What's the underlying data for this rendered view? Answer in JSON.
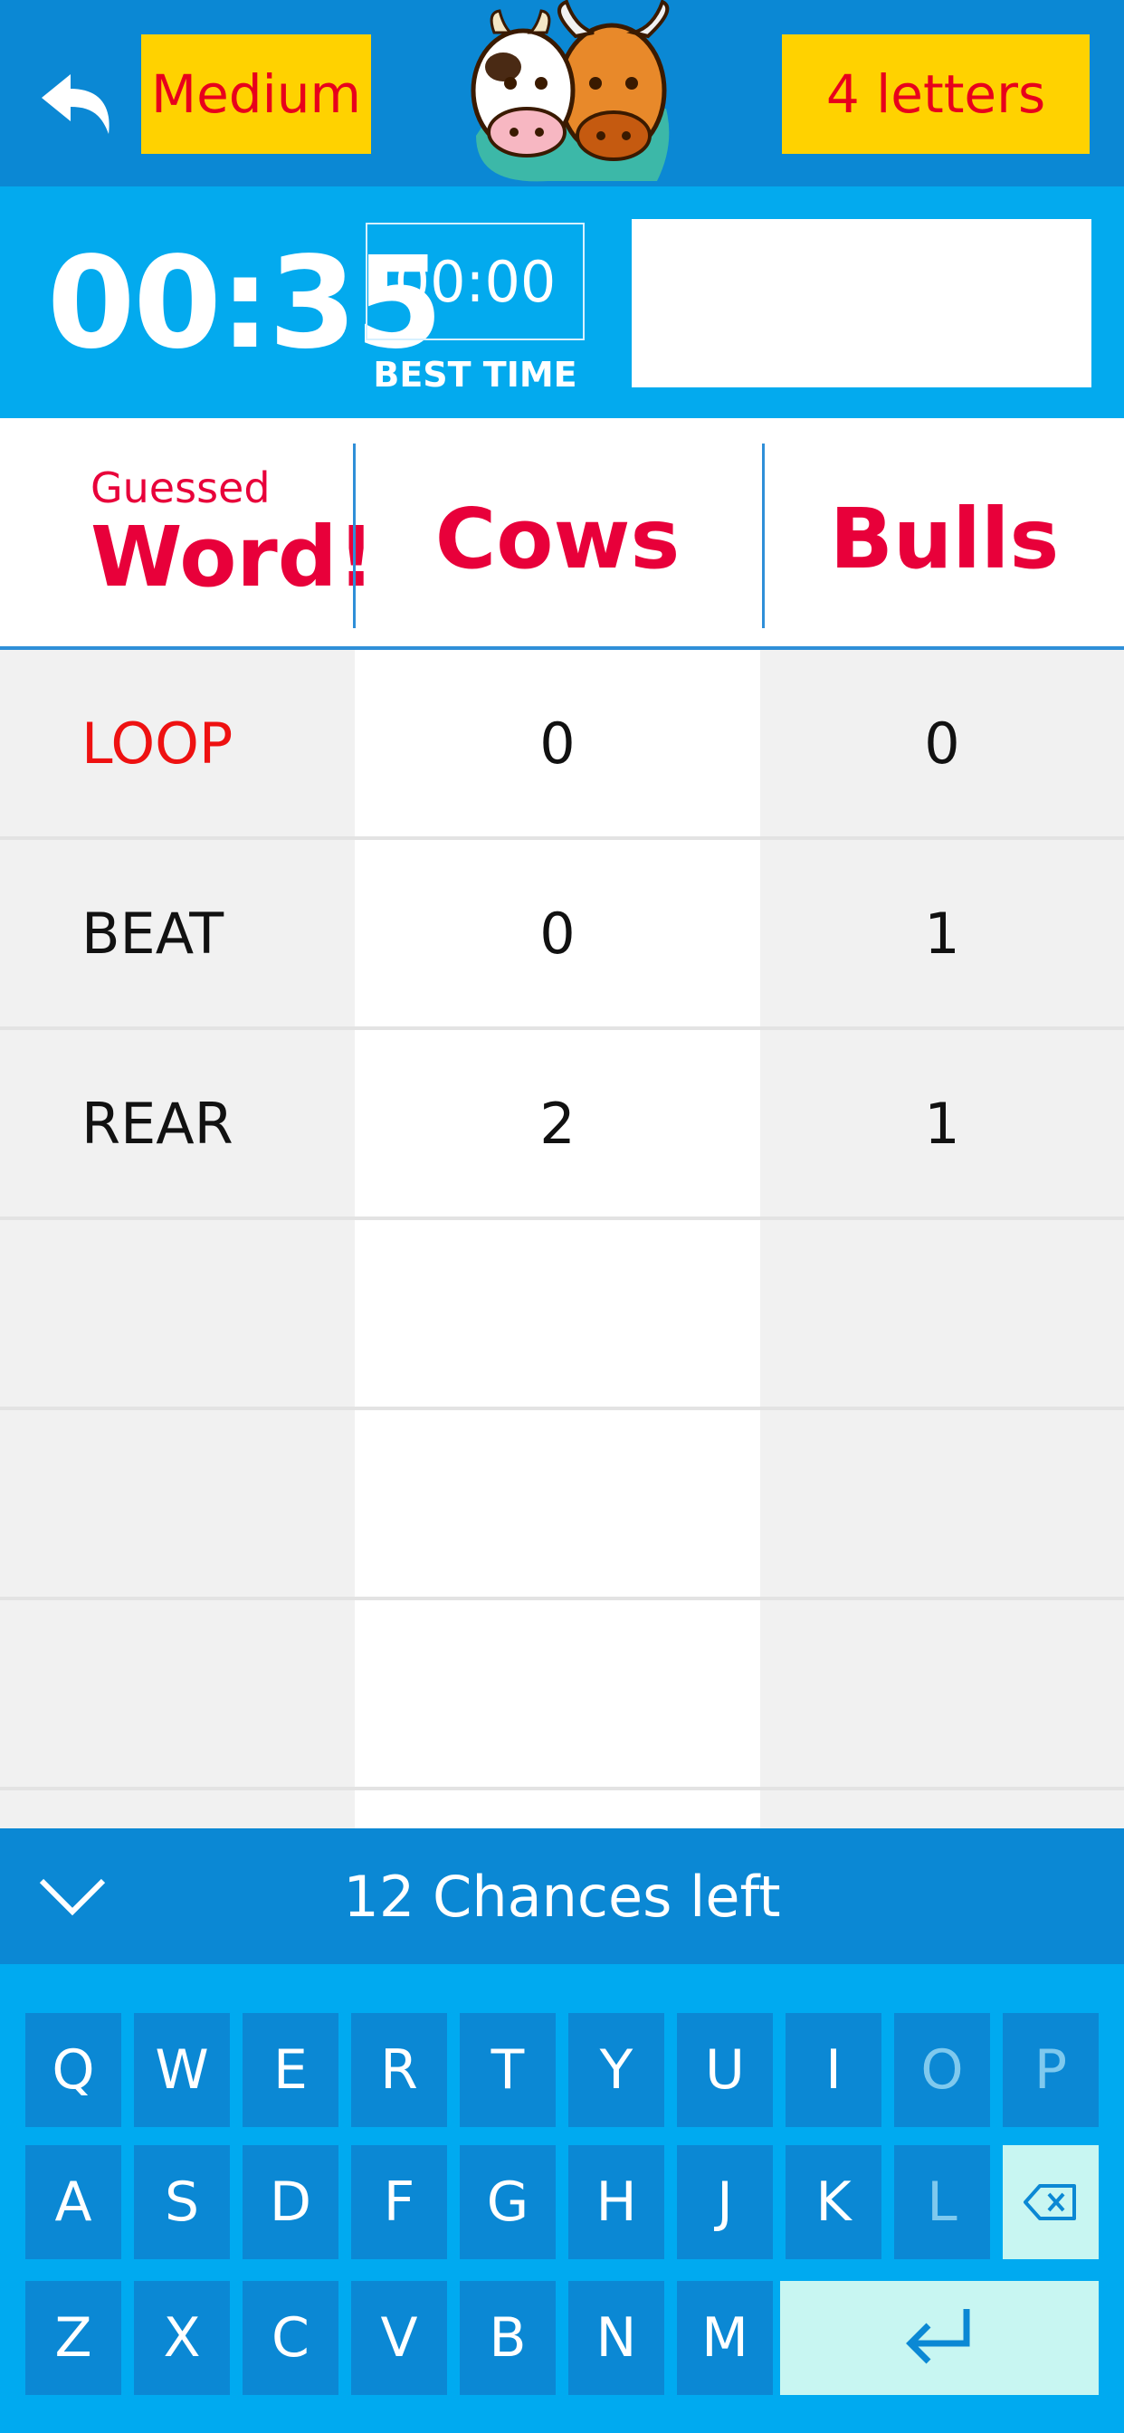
{
  "topbar": {
    "level_label": "Medium",
    "letters_label": "4 letters",
    "icons": {
      "back": "undo-arrow-icon",
      "logo": "cow-and-bull-logo"
    }
  },
  "timer": {
    "elapsed": "00:35",
    "best_time": "00:00",
    "best_time_label": "BEST TIME",
    "current_guess": ""
  },
  "table": {
    "header_word_small": "Guessed",
    "header_word_big": "Word!",
    "header_cows": "Cows",
    "header_bulls": "Bulls",
    "rows": [
      {
        "word": "LOOP",
        "cows": "0",
        "bulls": "0",
        "highlight": true
      },
      {
        "word": "BEAT",
        "cows": "0",
        "bulls": "1",
        "highlight": false
      },
      {
        "word": "REAR",
        "cows": "2",
        "bulls": "1",
        "highlight": false
      }
    ]
  },
  "status": {
    "chances_text": "12 Chances left",
    "collapse_icon": "chevron-down-icon"
  },
  "keyboard": {
    "row1": [
      "Q",
      "W",
      "E",
      "R",
      "T",
      "Y",
      "U",
      "I",
      "O",
      "P"
    ],
    "row2": [
      "A",
      "S",
      "D",
      "F",
      "G",
      "H",
      "J",
      "K",
      "L"
    ],
    "row3": [
      "Z",
      "X",
      "C",
      "V",
      "B",
      "N",
      "M"
    ],
    "disabled_keys": [
      "O",
      "P",
      "L"
    ],
    "backspace_icon": "backspace-icon",
    "enter_icon": "enter-icon"
  },
  "colors": {
    "topbar": "#0b88d4",
    "timerbar": "#03aaee",
    "accent_yellow": "#ffd200",
    "title_red": "#e8003a",
    "keyboard_bg": "#00aaf0"
  }
}
